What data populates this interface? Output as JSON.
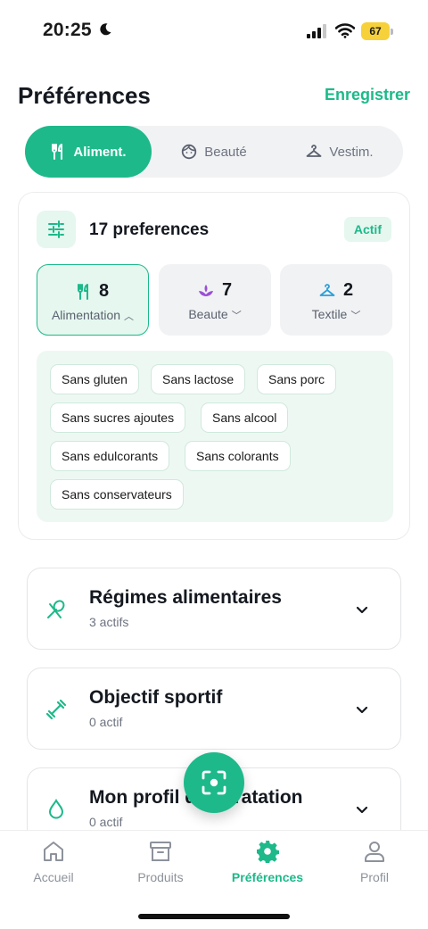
{
  "status": {
    "time": "20:25",
    "battery": "67"
  },
  "header": {
    "title": "Préférences",
    "save_label": "Enregistrer"
  },
  "segments": [
    {
      "label": "Aliment.",
      "icon": "fork-knife-icon",
      "active": true
    },
    {
      "label": "Beauté",
      "icon": "face-icon",
      "active": false
    },
    {
      "label": "Vestim.",
      "icon": "hanger-icon",
      "active": false
    }
  ],
  "summary": {
    "title": "17 preferences",
    "badge": "Actif",
    "categories": [
      {
        "count": "8",
        "label": "Alimentation",
        "icon": "fork-knife-icon",
        "expanded": true
      },
      {
        "count": "7",
        "label": "Beaute",
        "icon": "lotus-icon",
        "expanded": false
      },
      {
        "count": "2",
        "label": "Textile",
        "icon": "hanger-icon",
        "expanded": false
      }
    ],
    "tags": [
      "Sans gluten",
      "Sans lactose",
      "Sans porc",
      "Sans sucres ajoutes",
      "Sans alcool",
      "Sans edulcorants",
      "Sans colorants",
      "Sans conservateurs"
    ]
  },
  "sections": [
    {
      "title": "Régimes alimentaires",
      "subtitle": "3 actifs",
      "icon": "salad-icon"
    },
    {
      "title": "Objectif sportif",
      "subtitle": "0 actif",
      "icon": "dumbbell-icon"
    },
    {
      "title": "Mon profil d'hydratation",
      "subtitle": "0 actif",
      "icon": "droplet-icon"
    }
  ],
  "tabbar": [
    {
      "label": "Accueil",
      "icon": "home-icon",
      "active": false
    },
    {
      "label": "Produits",
      "icon": "archive-box-icon",
      "active": false
    },
    {
      "label": "Préférences",
      "icon": "gear-icon",
      "active": true
    },
    {
      "label": "Profil",
      "icon": "user-icon",
      "active": false
    }
  ],
  "colors": {
    "accent": "#1db98a",
    "accent_soft": "#e5f7ef",
    "muted": "#8d929b"
  }
}
